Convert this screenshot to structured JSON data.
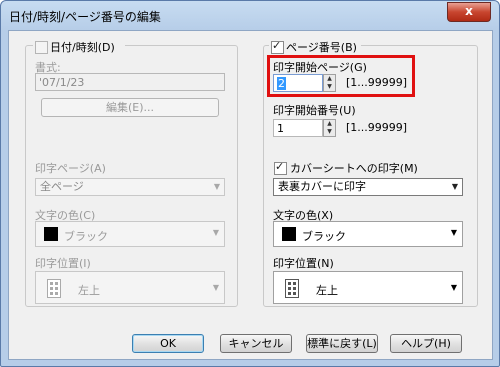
{
  "window": {
    "title": "日付/時刻/ページ番号の編集",
    "close_label": "x"
  },
  "left": {
    "datetime_label": "日付/時刻(D)",
    "format_label": "書式:",
    "format_value": "'07/1/23",
    "edit_button": "編集(E)...",
    "print_page_label": "印字ページ(A)",
    "print_page_value": "全ページ",
    "text_color_label": "文字の色(C)",
    "text_color_value": "ブラック",
    "print_position_label": "印字位置(I)",
    "print_position_value": "左上"
  },
  "right": {
    "page_number_label": "ページ番号(B)",
    "start_page_label": "印字開始ページ(G)",
    "start_page_value": "2",
    "start_page_range": "[1...99999]",
    "start_number_label": "印字開始番号(U)",
    "start_number_value": "1",
    "start_number_range": "[1...99999]",
    "cover_print_label": "カバーシートへの印字(M)",
    "cover_print_value": "表裏カバーに印字",
    "text_color_label": "文字の色(X)",
    "text_color_value": "ブラック",
    "print_position_label": "印字位置(N)",
    "print_position_value": "左上"
  },
  "footer": {
    "ok": "OK",
    "cancel": "キャンセル",
    "restore_default": "標準に戻す(L)",
    "help": "ヘルプ(H)"
  },
  "colors": {
    "highlight": "#e01010",
    "swatch": "#000000"
  }
}
